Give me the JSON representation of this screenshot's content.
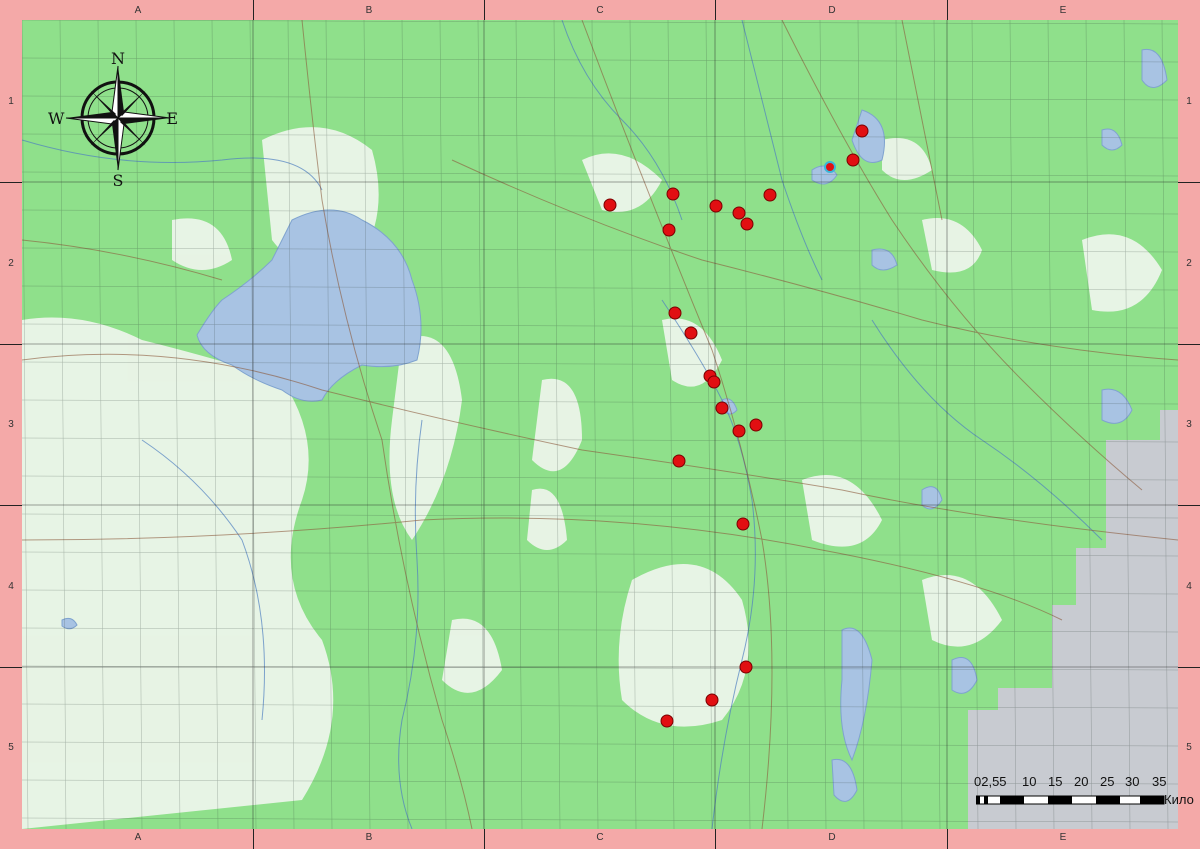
{
  "grid": {
    "columns": [
      "A",
      "B",
      "C",
      "D",
      "E"
    ],
    "rows": [
      "1",
      "2",
      "3",
      "4",
      "5"
    ]
  },
  "compass": {
    "n": "N",
    "s": "S",
    "e": "E",
    "w": "W"
  },
  "scale": {
    "labels": [
      "02,55",
      "10",
      "15",
      "20",
      "25",
      "30",
      "35"
    ],
    "unit": "Кило"
  },
  "colors": {
    "frame": "#f4a9a8",
    "forest": "#8fe08b",
    "water": "#a8c3e3",
    "nodata": "#c8cbd1",
    "marker": "#e10f12"
  },
  "markers_count": 24
}
